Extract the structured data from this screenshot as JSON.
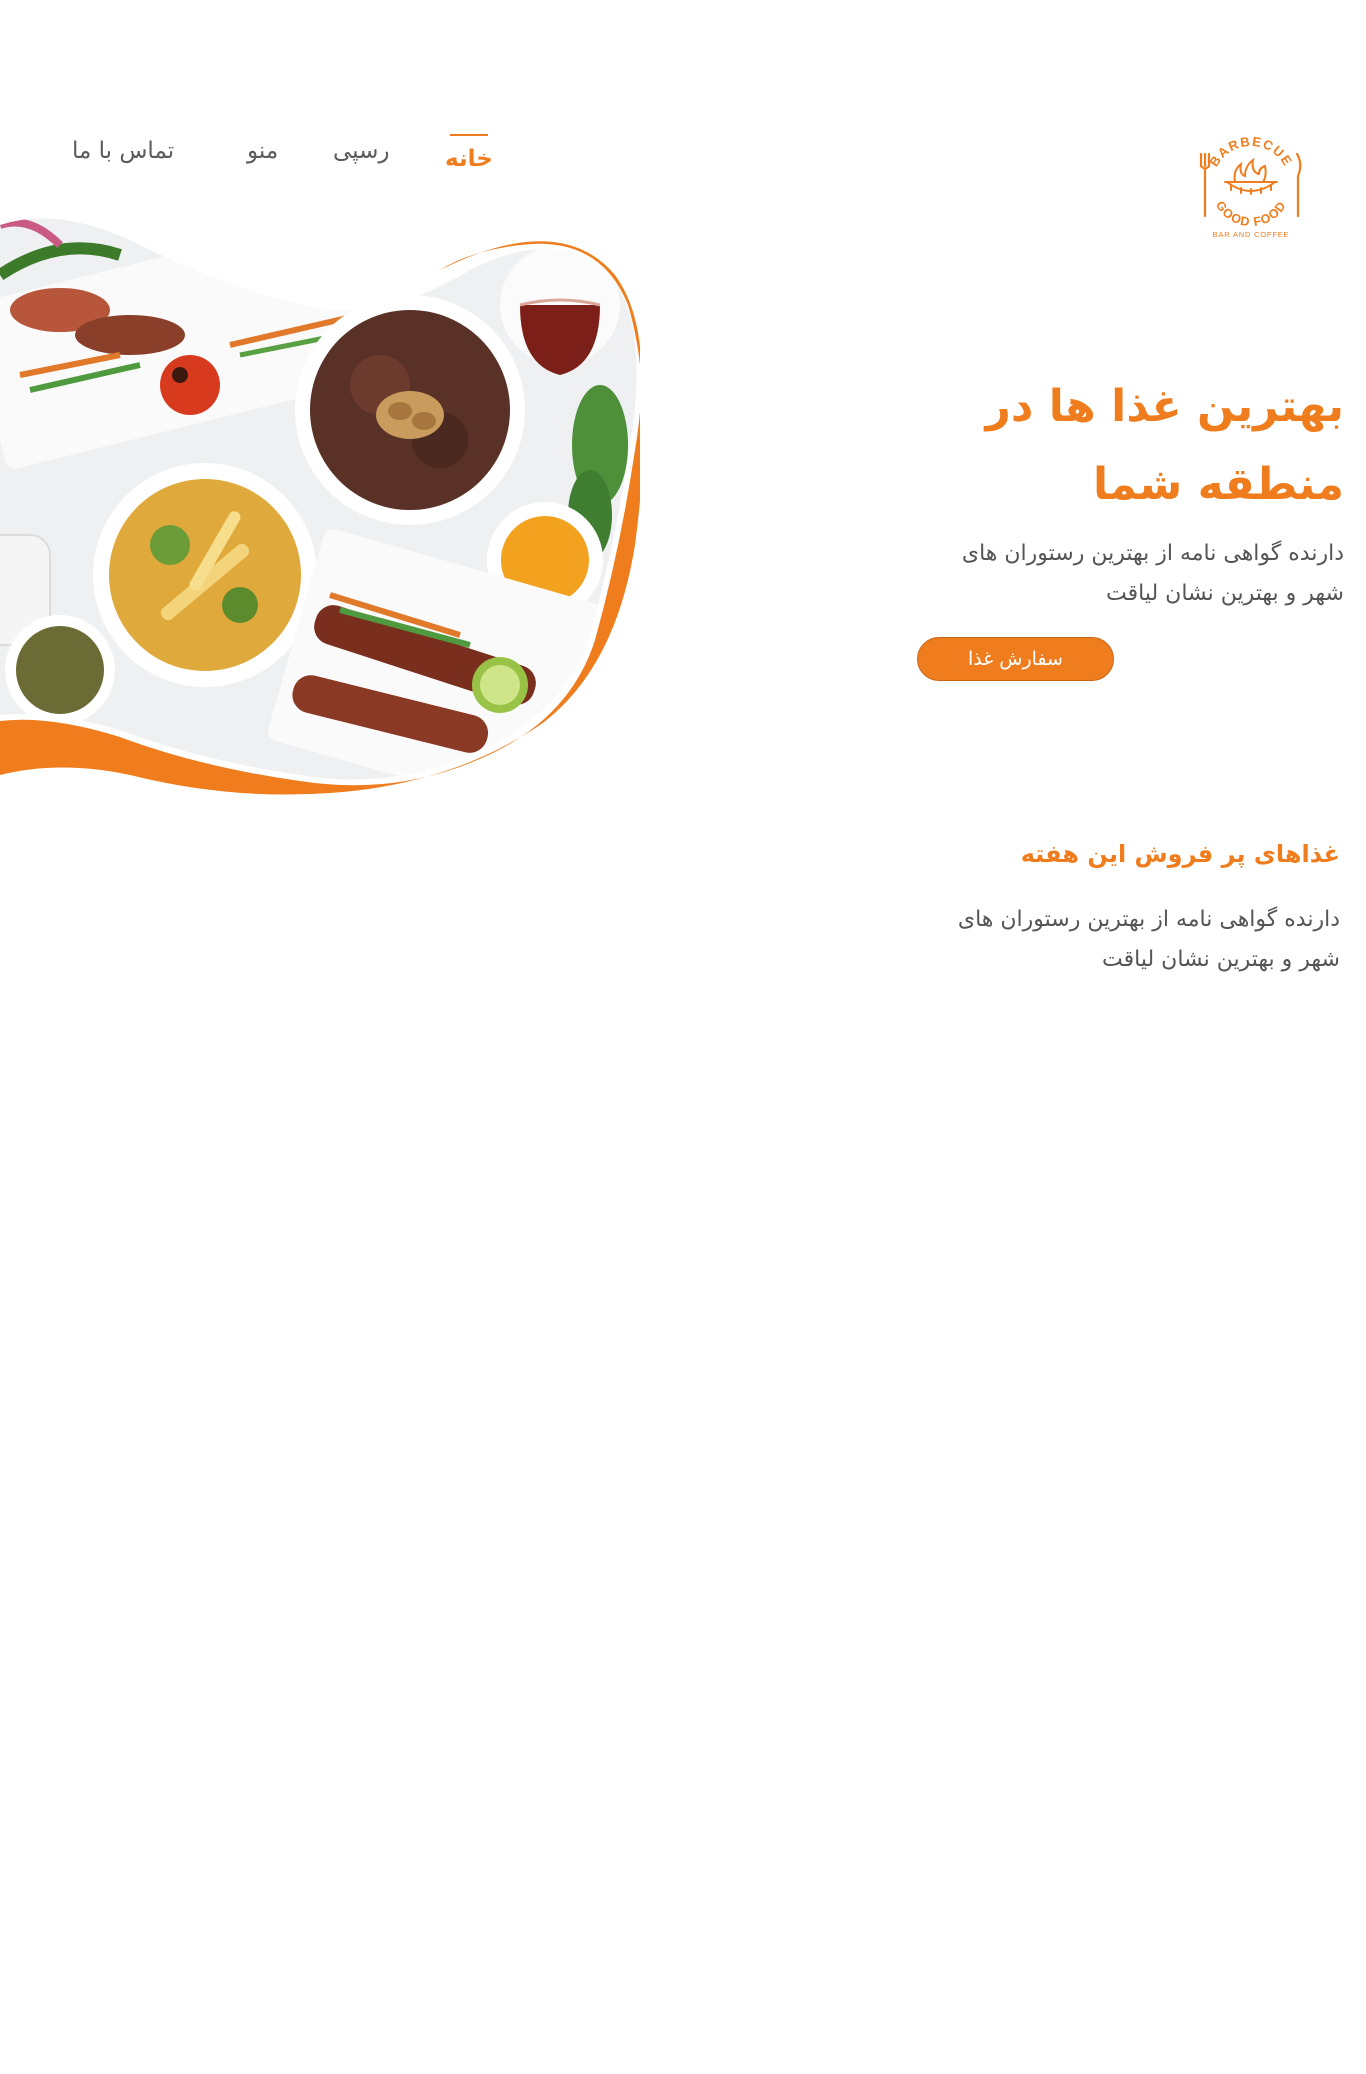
{
  "logo": {
    "top_text": "BARBECUE",
    "middle_text": "GOOD FOOD",
    "bottom_text": "BAR AND COFFEE",
    "color": "#ef7d1e"
  },
  "nav": {
    "home": "خانه",
    "recipe": "رسپی",
    "menu": "منو",
    "contact": "تماس با ما",
    "active": "home"
  },
  "hero": {
    "title_line1": "بهترین غذا ها در",
    "title_line2": "منطقه شما",
    "subtitle_line1": "دارنده گواهی نامه از بهترین رستوران های",
    "subtitle_line2": "شهر و بهترین نشان لیاقت",
    "button": "سفارش غذا",
    "image": "food-platter-image"
  },
  "best_sellers": {
    "title": "غذاهای پر فروش این هفته",
    "subtitle_line1": "دارنده گواهی نامه از بهترین رستوران های",
    "subtitle_line2": "شهر و بهترین نشان لیاقت"
  },
  "colors": {
    "accent": "#ef7d1e",
    "text": "#555555",
    "background": "#ffffff"
  }
}
